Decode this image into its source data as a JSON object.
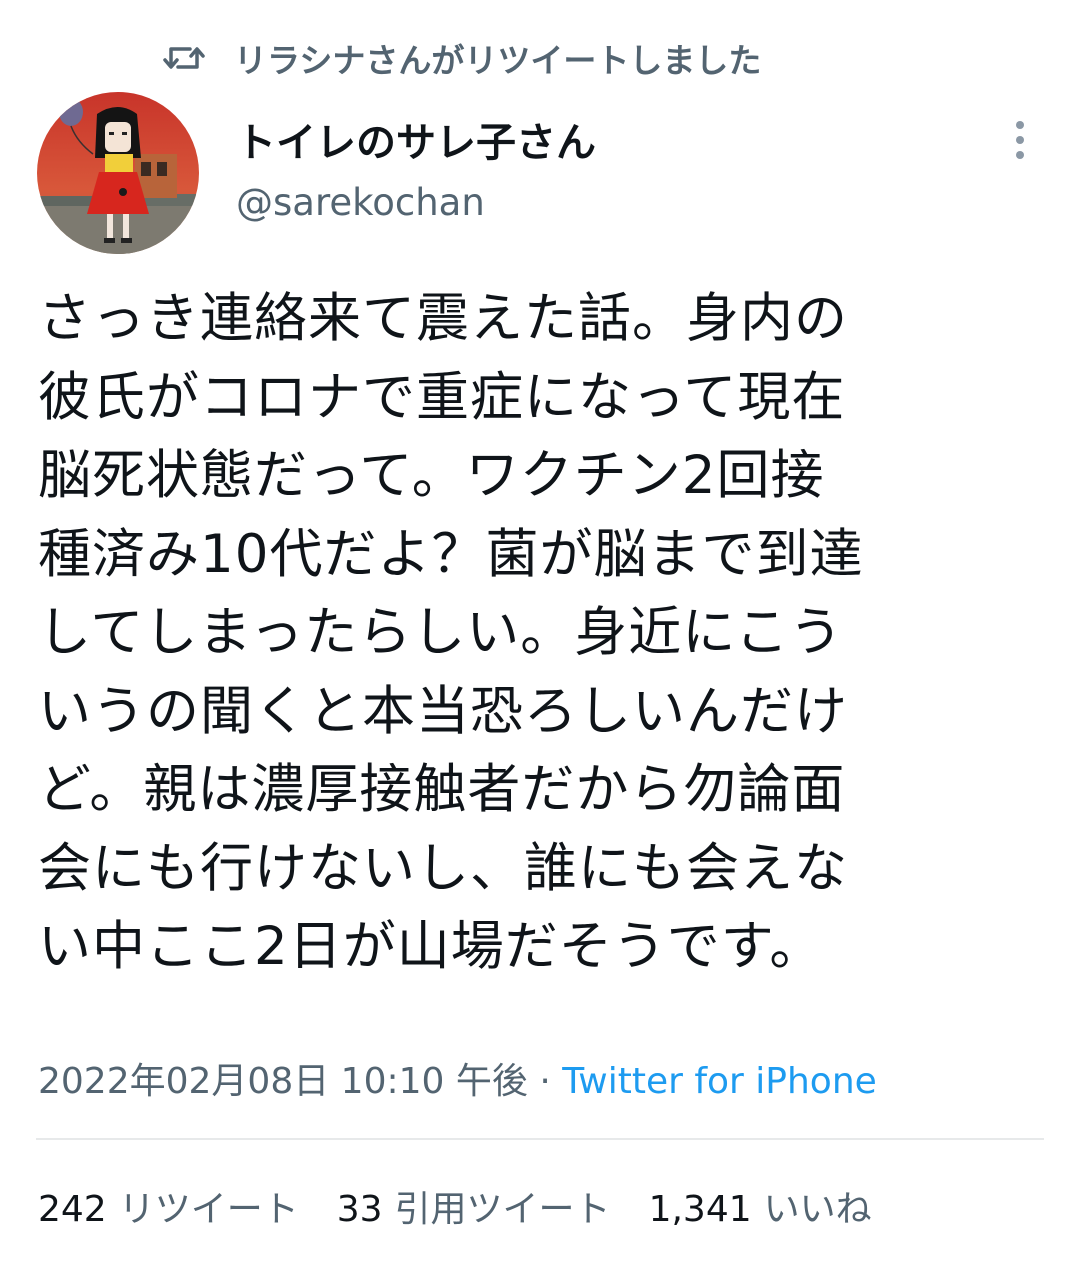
{
  "retweet_header": {
    "icon": "retweet-icon",
    "text": "リラシナさんがリツイートしました"
  },
  "author": {
    "display_name": "トイレのサレ子さん",
    "handle": "@sarekochan",
    "avatar": "avatar-illustration"
  },
  "tweet": {
    "lines": [
      "さっき連絡来て震えた話。身内の",
      "彼氏がコロナで重症になって現在",
      "脳死状態だって。ワクチン2回接",
      "種済み10代だよ？菌が脳まで到達",
      "してしまったらしい。身近にこう",
      "いうの聞くと本当恐ろしいんだけ",
      "ど。親は濃厚接触者だから勿論面",
      "会にも行けないし、誰にも会えな",
      "い中ここ2日が山場だそうです。"
    ]
  },
  "meta": {
    "timestamp": "2022年02月08日 10:10 午後",
    "separator": "·",
    "source": "Twitter for iPhone"
  },
  "stats": {
    "retweets": {
      "count": "242",
      "label": "リツイート"
    },
    "quotes": {
      "count": "33",
      "label": "引用ツイート"
    },
    "likes": {
      "count": "1,341",
      "label": "いいね"
    }
  },
  "colors": {
    "text_primary": "#0f1419",
    "text_secondary": "#536471",
    "link": "#1d9bf0",
    "divider": "#e7e9ea"
  }
}
